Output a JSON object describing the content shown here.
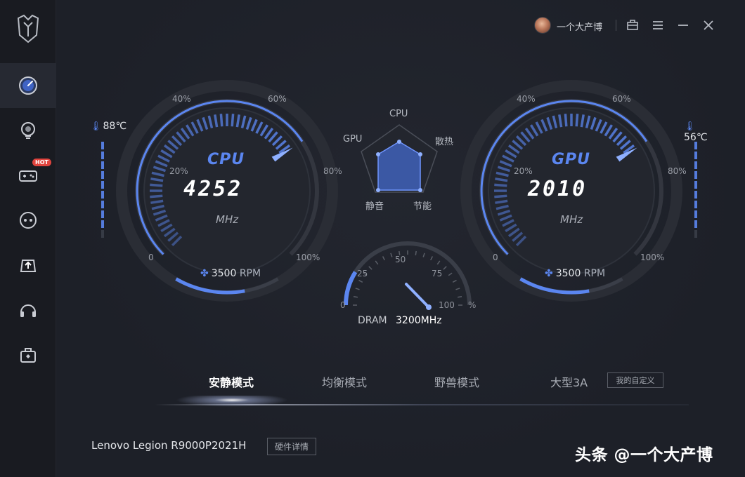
{
  "header": {
    "username": "一个大产博"
  },
  "sidebar": {
    "items": [
      {
        "icon": "speedometer-icon",
        "active": true
      },
      {
        "icon": "lightbulb-icon"
      },
      {
        "icon": "gamepad-icon",
        "badge": "HOT"
      },
      {
        "icon": "chat-bot-icon"
      },
      {
        "icon": "upload-tray-icon"
      },
      {
        "icon": "headset-icon"
      },
      {
        "icon": "toolbox-icon"
      }
    ]
  },
  "cpu_gauge": {
    "title": "CPU",
    "value": "4252",
    "unit": "MHz",
    "temperature": "88℃",
    "fan_speed": "3500",
    "fan_unit": "RPM",
    "ticks": [
      "0",
      "20%",
      "40%",
      "60%",
      "80%",
      "100%"
    ],
    "load_fraction": 0.71
  },
  "gpu_gauge": {
    "title": "GPU",
    "value": "2010",
    "unit": "MHz",
    "temperature": "56℃",
    "fan_speed": "3500",
    "fan_unit": "RPM",
    "ticks": [
      "0",
      "20%",
      "40%",
      "60%",
      "80%",
      "100%"
    ],
    "load_fraction": 0.71
  },
  "radar": {
    "labels": [
      "CPU",
      "散热",
      "节能",
      "静音",
      "GPU"
    ]
  },
  "dram": {
    "label": "DRAM",
    "value": "3200MHz",
    "percent_symbol": "%",
    "ticks": [
      "0",
      "25",
      "50",
      "75",
      "100"
    ],
    "usage_percent": 18
  },
  "modes": {
    "items": [
      "安静模式",
      "均衡模式",
      "野兽模式",
      "大型3A"
    ],
    "active": "安静模式",
    "custom_label": "我的自定义"
  },
  "footer": {
    "device_name": "Lenovo Legion R9000P2021H",
    "hardware_button": "硬件详情",
    "watermark": "头条 @一个大产博"
  },
  "colors": {
    "accent": "#5b86f0",
    "background": "#1e2129",
    "sidebar": "#191b21"
  }
}
